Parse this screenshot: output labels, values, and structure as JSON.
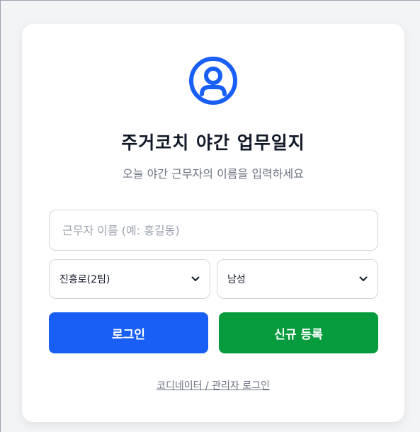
{
  "login": {
    "title": "주거코치 야간 업무일지",
    "subtitle": "오늘 야간 근무자의 이름을 입력하세요",
    "name_placeholder": "근무자 이름 (예: 홍길동)",
    "name_value": "",
    "team_select": "진흥로(2팀)",
    "gender_select": "남성",
    "login_label": "로그인",
    "register_label": "신규 등록",
    "admin_link": "코디네이터 / 관리자 로그인",
    "icon": "user-circle-icon"
  },
  "colors": {
    "primary": "#1a5ff5",
    "success": "#069b3d",
    "icon": "#1a5ff5"
  }
}
